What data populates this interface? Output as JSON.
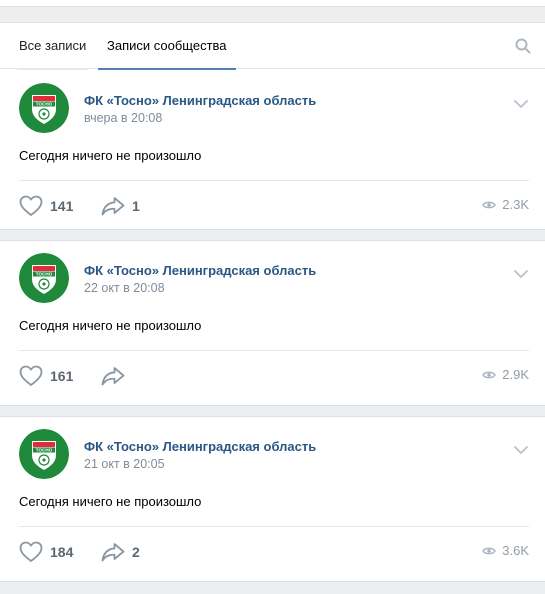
{
  "tabs": {
    "all_posts": "Все записи",
    "community_posts": "Записи сообщества"
  },
  "icons": {
    "search": "search-icon",
    "like": "heart-icon",
    "share": "share-arrow-icon",
    "views": "eye-icon",
    "menu": "chevron-down-icon"
  },
  "colors": {
    "link": "#2a5885",
    "accent": "#5181b8",
    "muted": "#818c99",
    "logo_green": "#1f8a3c",
    "logo_red": "#e22c3d"
  },
  "community": {
    "name": "ФК «Тосно» Ленинградская область",
    "logo_text": "ТОСНО"
  },
  "posts": [
    {
      "date": "вчера в 20:08",
      "text": "Сегодня ничего не произошло",
      "likes": "141",
      "shares": "1",
      "views": "2.3K"
    },
    {
      "date": "22 окт в 20:08",
      "text": "Сегодня ничего не произошло",
      "likes": "161",
      "shares": "",
      "views": "2.9K"
    },
    {
      "date": "21 окт в 20:05",
      "text": "Сегодня ничего не произошло",
      "likes": "184",
      "shares": "2",
      "views": "3.6K"
    }
  ]
}
